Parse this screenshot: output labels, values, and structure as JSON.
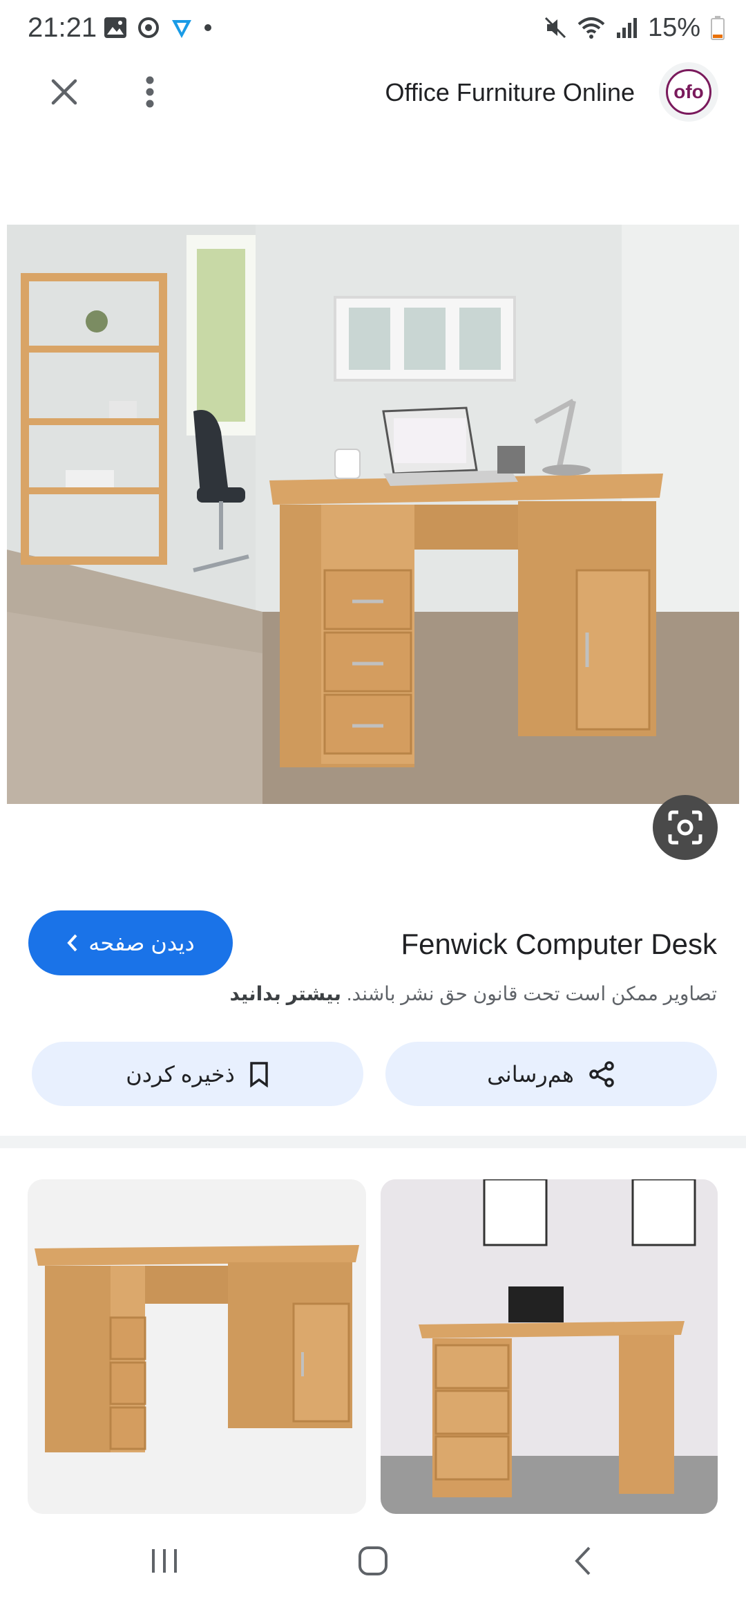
{
  "status_bar": {
    "time": "21:21",
    "battery": "15%"
  },
  "top_bar": {
    "site_name": "Office Furniture Online",
    "logo_text": "ofo",
    "icons": [
      "close-icon",
      "more-vert-icon"
    ]
  },
  "result": {
    "title": "Fenwick Computer Desk",
    "visit_button": "دیدن صفحه",
    "copyright_text": "تصاویر ممکن است تحت قانون حق نشر باشند.",
    "learn_more": "بیشتر بدانید",
    "share_label": "هم‌رسانی",
    "save_label": "ذخیره کردن"
  },
  "colors": {
    "accent": "#1a73e8",
    "tonal_button": "#e8f0fe",
    "wood": "#d9a466",
    "logo": "#7a1a5c"
  }
}
